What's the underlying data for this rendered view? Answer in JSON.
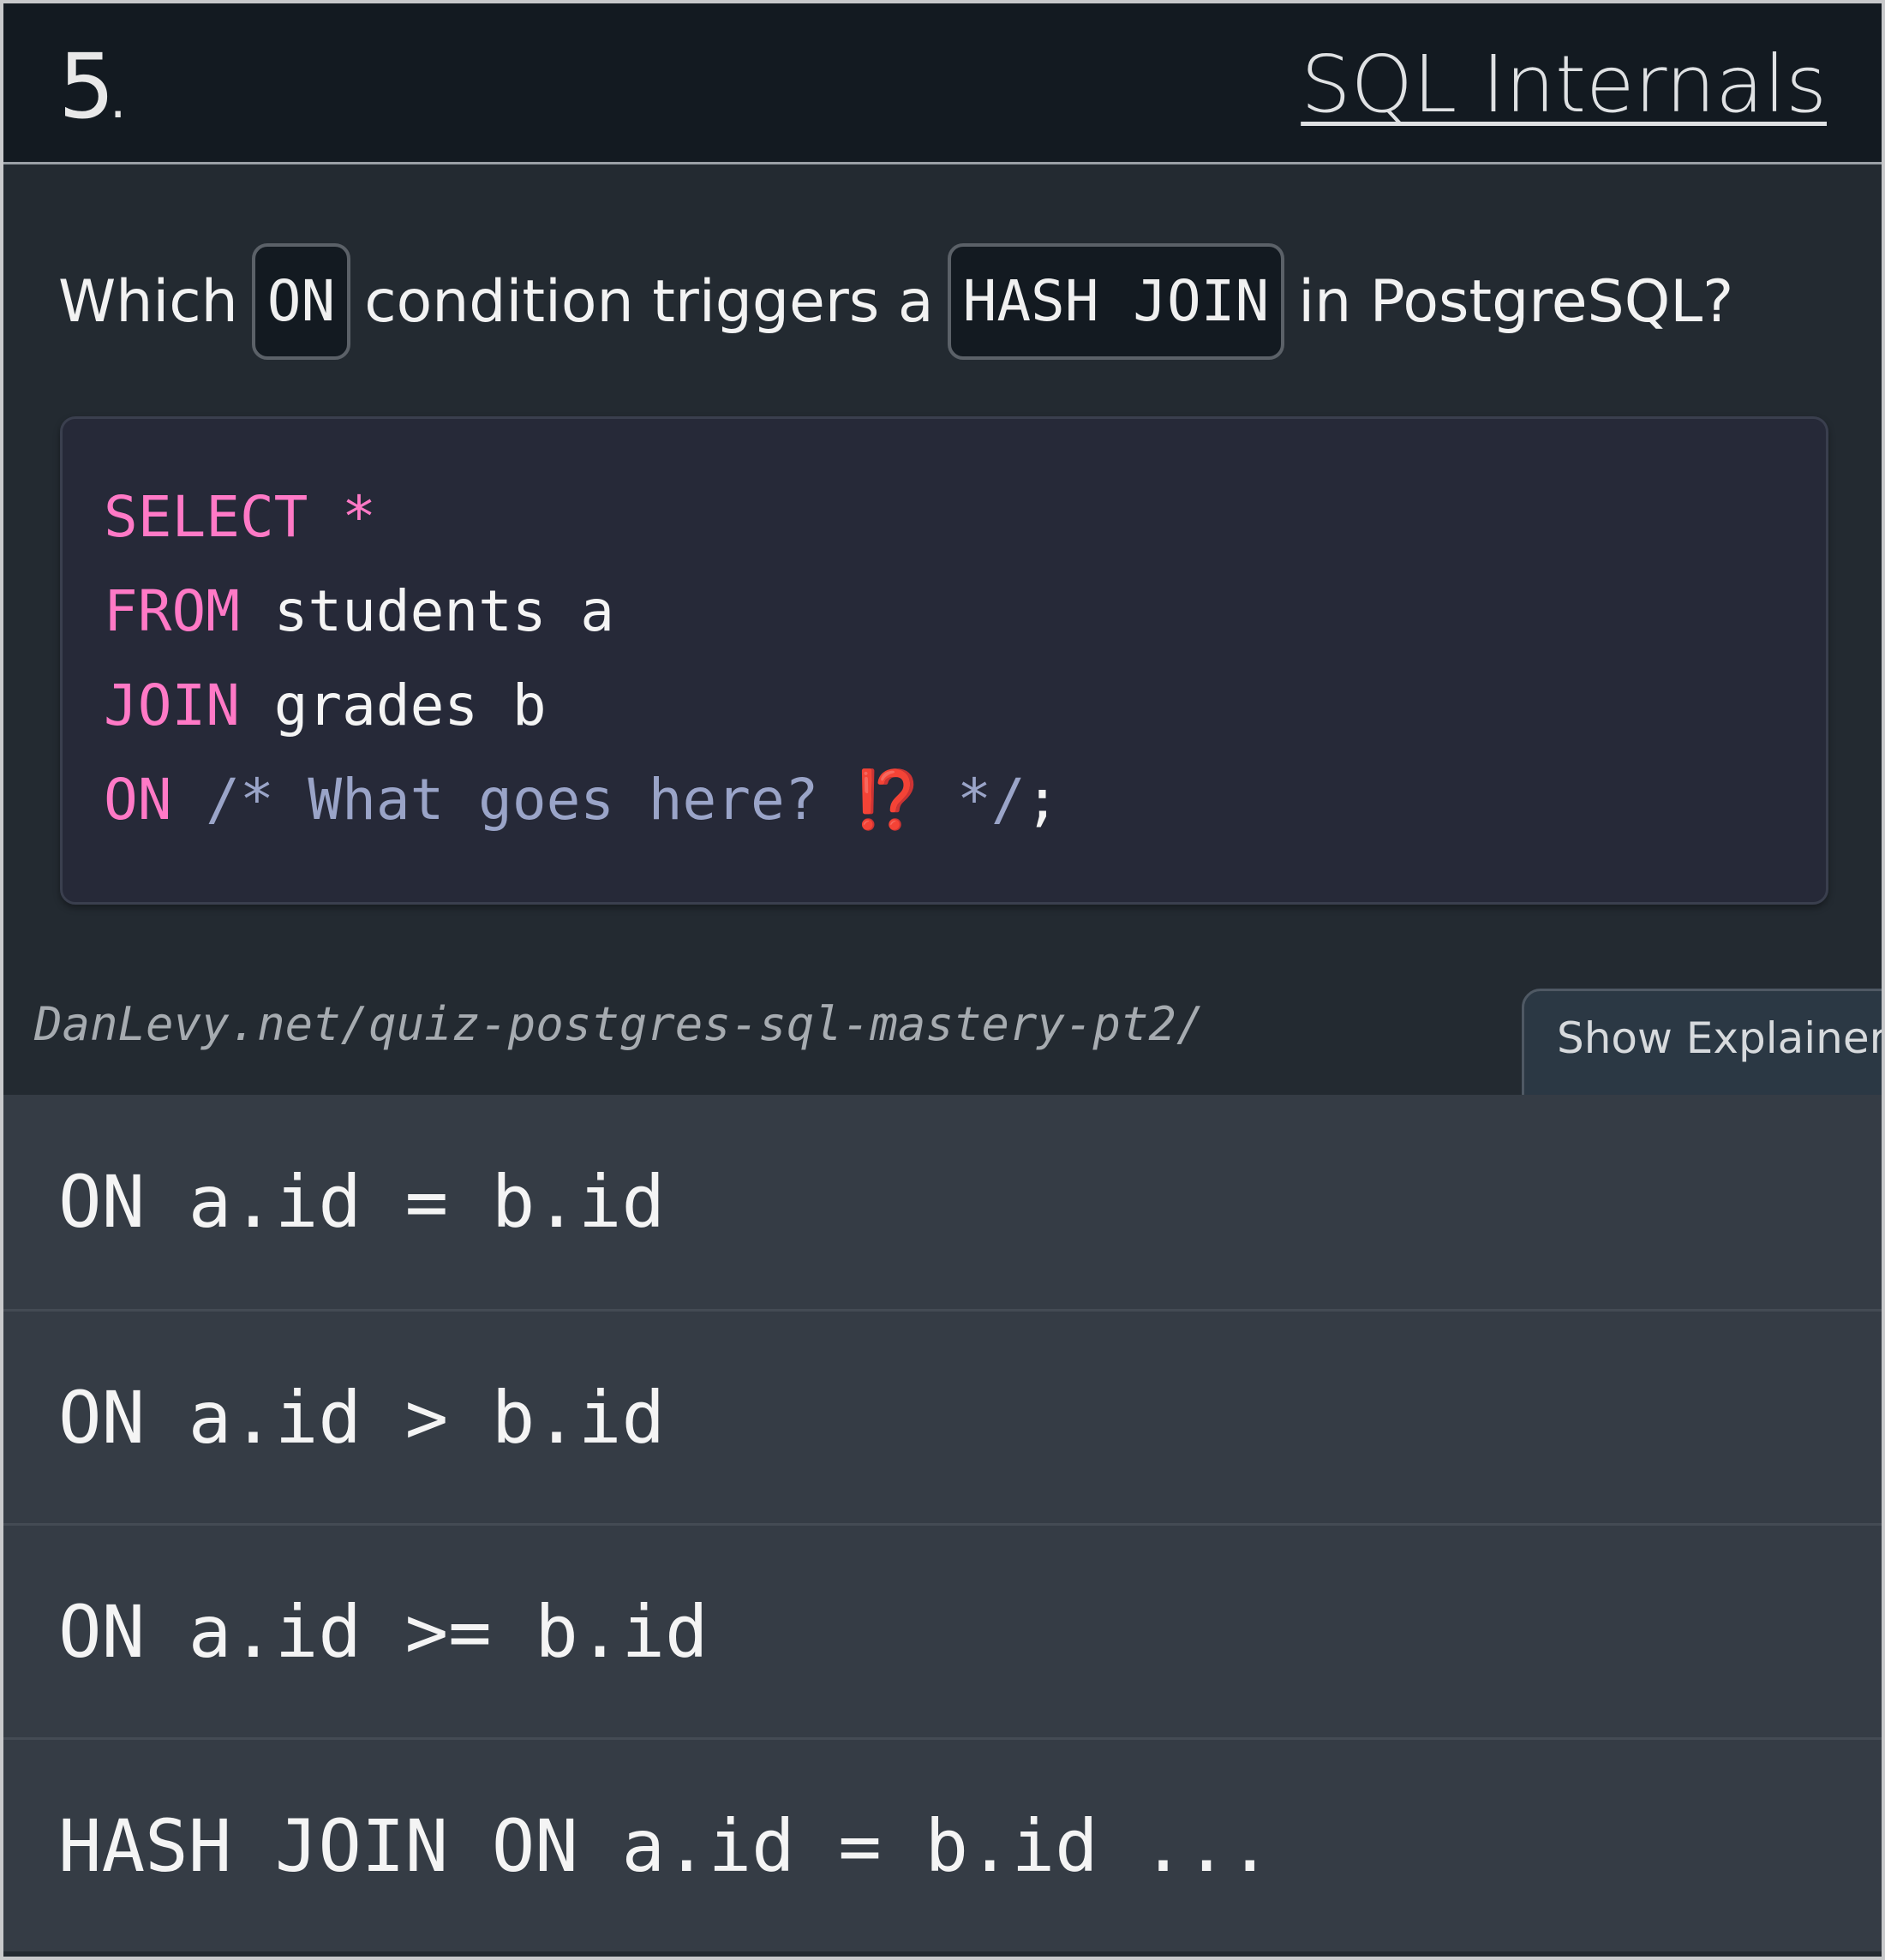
{
  "header": {
    "question_number": "5",
    "number_suffix": ".",
    "category": "SQL Internals"
  },
  "question": {
    "part1": "Which",
    "code1": "ON",
    "part2": "condition triggers a",
    "code2": "HASH JOIN",
    "part3": "in PostgreSQL?"
  },
  "code": {
    "line1_kw": "SELECT *",
    "line2_kw": "FROM",
    "line2_rest": " students a",
    "line3_kw": "JOIN",
    "line3_rest": " grades b",
    "line4_kw": "ON",
    "line4_comment": " /* What goes here? ⁉️ */",
    "line4_end": ";"
  },
  "footer": {
    "url": "DanLevy.net/quiz-postgres-sql-mastery-pt2/",
    "explainer_label": "Show Explainer"
  },
  "options": [
    "ON a.id = b.id",
    "ON a.id > b.id",
    "ON a.id >= b.id",
    "HASH JOIN ON a.id = b.id ..."
  ],
  "colors": {
    "keyword": "#ff79c6",
    "comment": "#9aa4c8",
    "background": "#232a31",
    "header_bg": "#131a21",
    "option_bg": "#353c45"
  }
}
